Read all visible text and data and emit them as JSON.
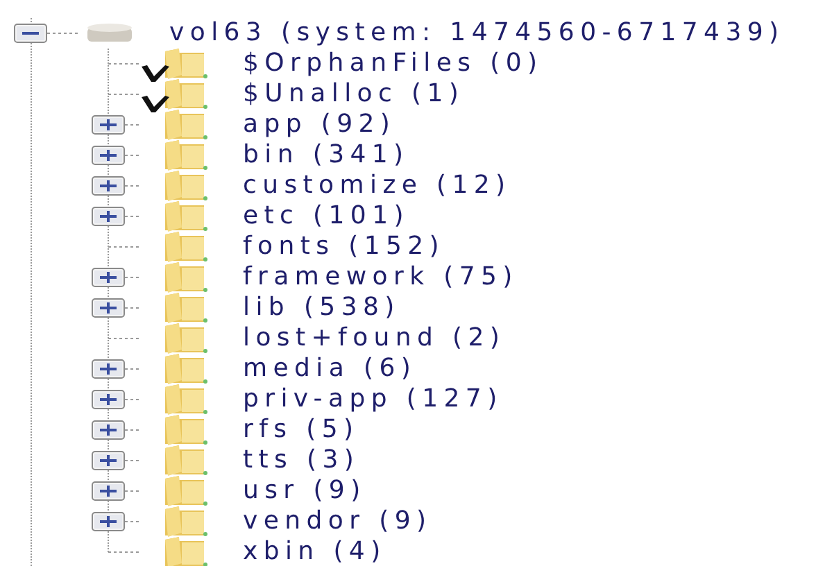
{
  "root": {
    "label": "vol63 (system: 1474560-6717439)",
    "expanded": true,
    "children": [
      {
        "label": "$OrphanFiles (0)",
        "checked": true,
        "expandable": false
      },
      {
        "label": "$Unalloc (1)",
        "checked": true,
        "expandable": false
      },
      {
        "label": "app (92)",
        "checked": false,
        "expandable": true
      },
      {
        "label": "bin (341)",
        "checked": false,
        "expandable": true
      },
      {
        "label": "customize (12)",
        "checked": false,
        "expandable": true
      },
      {
        "label": "etc (101)",
        "checked": false,
        "expandable": true
      },
      {
        "label": "fonts (152)",
        "checked": false,
        "expandable": false
      },
      {
        "label": "framework (75)",
        "checked": false,
        "expandable": true
      },
      {
        "label": "lib (538)",
        "checked": false,
        "expandable": true
      },
      {
        "label": "lost+found (2)",
        "checked": false,
        "expandable": false
      },
      {
        "label": "media (6)",
        "checked": false,
        "expandable": true
      },
      {
        "label": "priv-app (127)",
        "checked": false,
        "expandable": true
      },
      {
        "label": "rfs (5)",
        "checked": false,
        "expandable": true
      },
      {
        "label": "tts (3)",
        "checked": false,
        "expandable": true
      },
      {
        "label": "usr (9)",
        "checked": false,
        "expandable": true
      },
      {
        "label": "vendor (9)",
        "checked": false,
        "expandable": true
      },
      {
        "label": "xbin (4)",
        "checked": false,
        "expandable": false
      }
    ]
  }
}
